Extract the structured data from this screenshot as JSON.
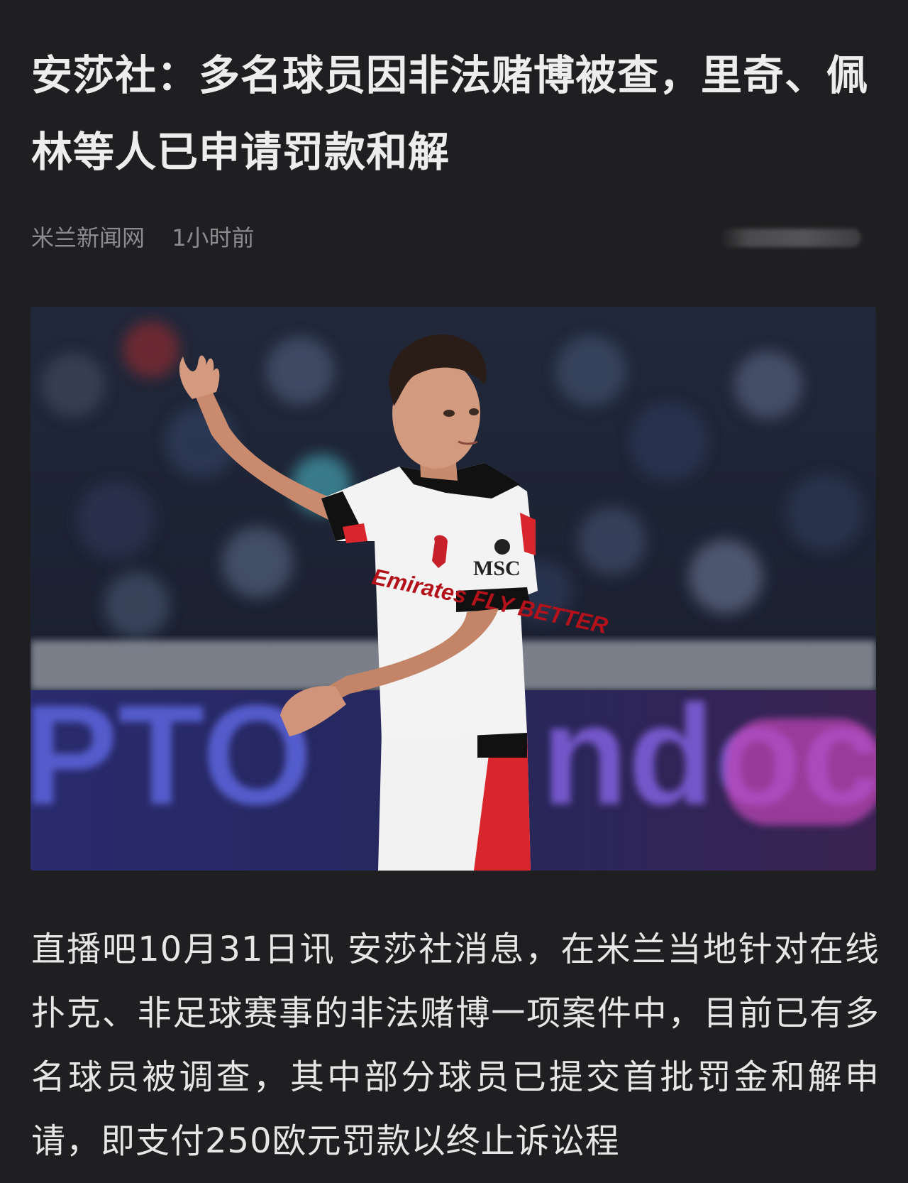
{
  "article": {
    "title": "安莎社：多名球员因非法赌博被查，里奇、佩林等人已申请罚款和解",
    "source": "米兰新闻网",
    "time": "1小时前",
    "image": {
      "subject": "football-player-photo",
      "shirt_sponsor_text": "Emirates FLY BETTER",
      "sleeve_sponsor_text": "MSC",
      "board_text_left": "PTO",
      "board_text_right": "ndoc"
    },
    "body": "直播吧10月31日讯  安莎社消息，在米兰当地针对在线扑克、非足球赛事的非法赌博一项案件中，目前已有多名球员被调查，其中部分球员已提交首批罚金和解申请，即支付250欧元罚款以终止诉讼程"
  },
  "colors": {
    "background": "#1f1f21",
    "title": "#ededed",
    "meta": "#8c8c8e",
    "body": "#e6e6e6"
  }
}
